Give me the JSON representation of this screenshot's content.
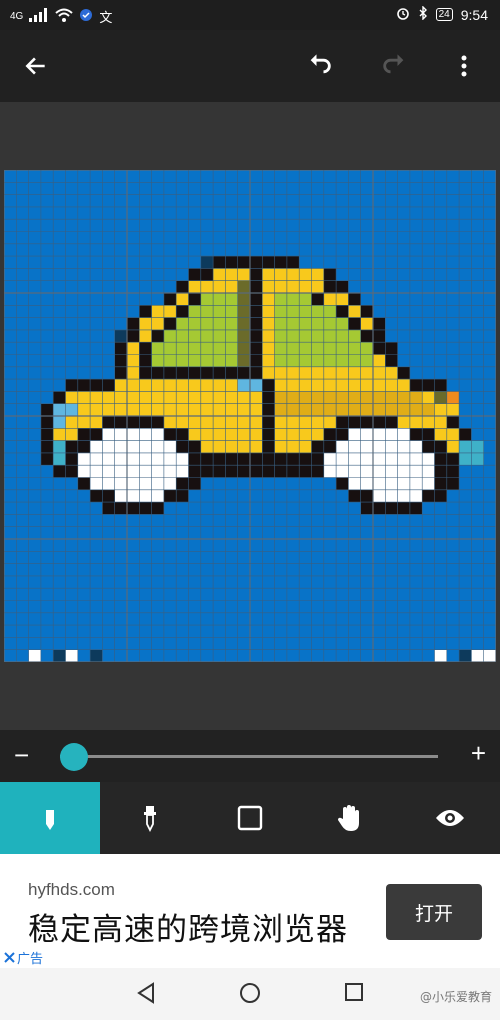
{
  "status_bar": {
    "network": "4G",
    "extra": "文",
    "battery": "24",
    "time": "9:54"
  },
  "toolbar": {
    "back_icon": "arrow-left-icon",
    "undo_icon": "undo-icon",
    "redo_icon": "redo-icon",
    "menu_icon": "more-vert-icon"
  },
  "zoom": {
    "minus": "−",
    "plus": "+",
    "level": 0.0
  },
  "tools": [
    {
      "name": "pencil",
      "icon": "pencil-icon",
      "active": true
    },
    {
      "name": "eyedropper",
      "icon": "eyedropper-icon",
      "active": false
    },
    {
      "name": "square",
      "icon": "square-icon",
      "active": false
    },
    {
      "name": "hand",
      "icon": "hand-icon",
      "active": false
    },
    {
      "name": "eye",
      "icon": "eye-icon",
      "active": false
    }
  ],
  "ad": {
    "domain": "hyfhds.com",
    "headline": "稳定高速的跨境浏览器",
    "button": "打开",
    "label": "广告"
  },
  "navbar": {
    "watermark": "@小乐爱教育"
  },
  "colors": {
    "accent": "#1fb2bd",
    "grid_bg": "#0873c8",
    "car_yellow": "#f8c91c",
    "window_green": "#a5c933"
  },
  "pixel_art": {
    "cols": 40,
    "rows": 40,
    "palette": {
      ".": "#0873c8",
      "K": "#171010",
      "Y": "#f8c91c",
      "D": "#e0ad17",
      "G": "#a5c933",
      "O": "#6b6b2a",
      "W": "#ffffff",
      "L": "#5fb6e0",
      "N": "#0d3a5c",
      "T": "#3fb1c8",
      "R": "#ef8b1e",
      "B": "#2b3a4a"
    },
    "rows_data": [
      "........................................",
      "........................................",
      "........................................",
      "........................................",
      "........................................",
      "........................................",
      "........................................",
      "................NKKKKKKK................",
      "...............KKYYYKYYYYYK.............",
      "..............KYYYYOKYYYYYKK............",
      ".............KYKGGGOKYGGGKYYK...........",
      "...........KYYKGGGGOKYGGGGGKYK..........",
      "..........KYYKGGGGGOKYGGGGGGKYK.........",
      ".........NKYKGGGGGGOKYGGGGGGGKK.........",
      ".........KYKGGGGGGGOKYGGGGGGGGKK........",
      ".........KYKGGGGGGGOKYGGGGGGGGYK........",
      ".........KYKKKKKKKKKKYYYYYYYYYYYK.......",
      ".....KKKKYYYYYYYYYYLLKYYYYYYYYYYYKKK.....",
      "....KYYYYYYYYYYYYYYYYKDDDDDDDDDDDDYOR....",
      "...KLLYYYYYYYYYYYYYYYKDDDDDDDDDDDDDYY....",
      "...KLYYYKKKKKYYYYYYYYKYYYYYKKKKKYYYYK....",
      "...KYYKKWWWWWKKYYYYYYKYYYYKKWWWWWKKYYK...",
      "...KTKKWWWWWWWKKYYYYYKYYYKKWWWWWWWKKYTT..",
      "...KTKWWWWWWWWWKKKKKKKKKKKWWWWWWWWWKKTT..",
      "....KKWWWWWWWWWKKKKKKKKKKKWWWWWWWWWKK....",
      "......KWWWWWWWKK...........KWWWWWWWKK....",
      ".......KKWWWWKK.............KKWWWWKK.....",
      "........KKKKK................KKKKK.......",
      "........................................",
      "........................................",
      "........................................",
      "........................................",
      "........................................",
      "........................................",
      "........................................",
      "........................................",
      "........................................",
      "........................................",
      "........................................",
      "..W.NW.N...........................W.NWW.NB.N"
    ]
  }
}
